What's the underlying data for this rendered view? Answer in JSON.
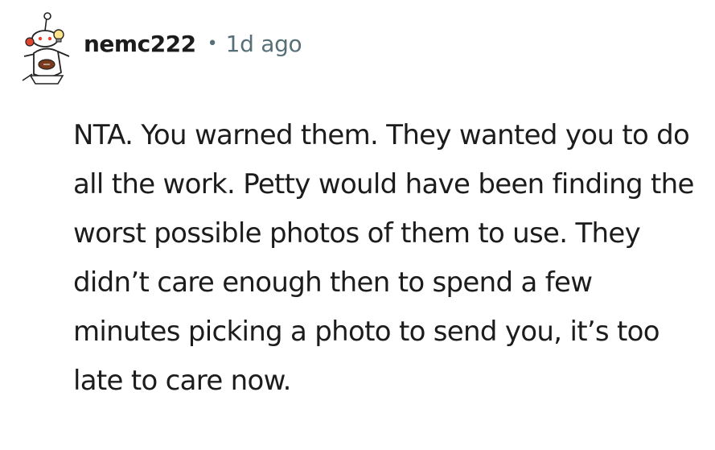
{
  "comment": {
    "author": "nemc222",
    "separator": "•",
    "timestamp": "1d ago",
    "body": "NTA. You warned them. They wanted you to do all the work. Petty would have been finding the worst possible photos of them to use. They didn’t care enough then to spend a few minutes picking a photo to send you, it’s too late to care now."
  },
  "icons": {
    "avatar": "snoo-avatar-icon"
  },
  "colors": {
    "text": "#1c1c1c",
    "meta": "#576f76",
    "background": "#ffffff"
  }
}
